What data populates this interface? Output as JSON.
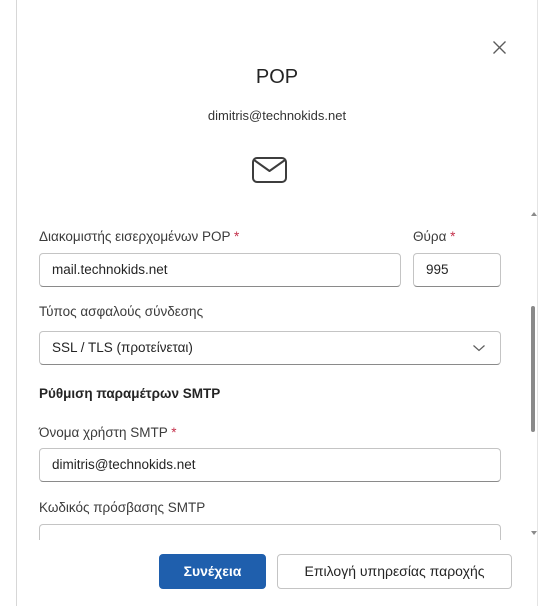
{
  "dialog": {
    "title": "POP",
    "account_email": "dimitris@technokids.net"
  },
  "form": {
    "incoming_server": {
      "label": "Διακομιστής εισερχομένων POP",
      "required_mark": "*",
      "value": "mail.technokids.net"
    },
    "port": {
      "label": "Θύρα",
      "required_mark": "*",
      "value": "995"
    },
    "secure_connection": {
      "label": "Τύπος ασφαλούς σύνδεσης",
      "selected": "SSL / TLS (προτείνεται)"
    },
    "smtp_section": {
      "heading": "Ρύθμιση παραμέτρων SMTP"
    },
    "smtp_username": {
      "label": "Όνομα χρήστη SMTP",
      "required_mark": "*",
      "value": "dimitris@technokids.net"
    },
    "smtp_password": {
      "label": "Κωδικός πρόσβασης SMTP",
      "value": ""
    }
  },
  "actions": {
    "continue_label": "Συνέχεια",
    "choose_provider_label": "Επιλογή υπηρεσίας παροχής"
  },
  "icons": {
    "close": "close-icon",
    "mail": "envelope-icon",
    "dropdown": "chevron-down-icon"
  },
  "colors": {
    "primary_button": "#1f5fad",
    "required_mark": "#c4314b",
    "border": "#c4c4c4"
  }
}
